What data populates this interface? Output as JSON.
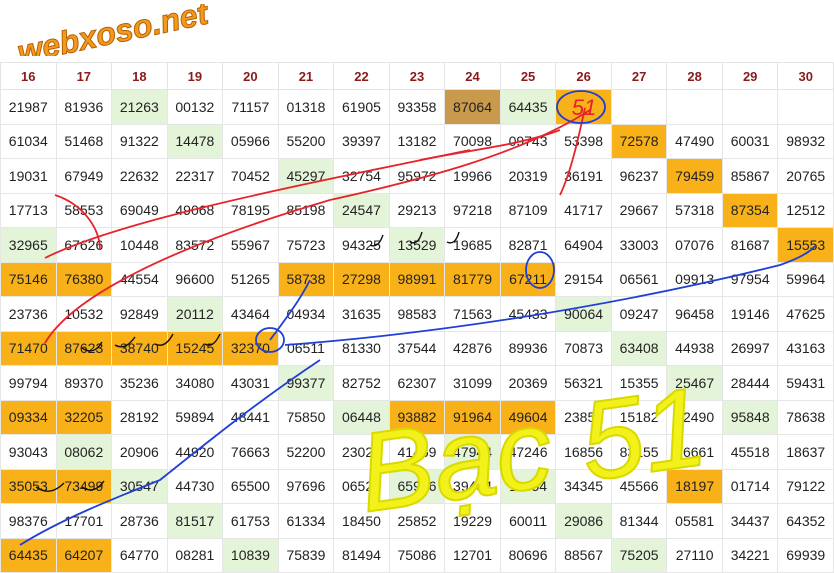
{
  "site": {
    "logo_text": "webxoso.net"
  },
  "columns": [
    "16",
    "17",
    "18",
    "19",
    "20",
    "21",
    "22",
    "23",
    "24",
    "25",
    "26",
    "27",
    "28",
    "29",
    "30"
  ],
  "rows": [
    [
      {
        "v": "21987"
      },
      {
        "v": "81936"
      },
      {
        "v": "21263",
        "c": "g"
      },
      {
        "v": "00132"
      },
      {
        "v": "71157"
      },
      {
        "v": "01318"
      },
      {
        "v": "61905"
      },
      {
        "v": "93358"
      },
      {
        "v": "87064",
        "c": "d"
      },
      {
        "v": "64435",
        "c": "g"
      },
      {
        "v": "",
        "c": "o"
      },
      {
        "v": ""
      },
      {
        "v": ""
      },
      {
        "v": ""
      },
      {
        "v": ""
      }
    ],
    [
      {
        "v": "61034"
      },
      {
        "v": "51468"
      },
      {
        "v": "91322"
      },
      {
        "v": "14478",
        "c": "g"
      },
      {
        "v": "05966"
      },
      {
        "v": "55200"
      },
      {
        "v": "39397"
      },
      {
        "v": "13182"
      },
      {
        "v": "70098"
      },
      {
        "v": "09743"
      },
      {
        "v": "53398"
      },
      {
        "v": "72578",
        "c": "o"
      },
      {
        "v": "47490"
      },
      {
        "v": "60031"
      },
      {
        "v": "98932"
      }
    ],
    [
      {
        "v": "19031"
      },
      {
        "v": "67949"
      },
      {
        "v": "22632"
      },
      {
        "v": "22317"
      },
      {
        "v": "70452"
      },
      {
        "v": "45297",
        "c": "g"
      },
      {
        "v": "32754"
      },
      {
        "v": "95972"
      },
      {
        "v": "19966"
      },
      {
        "v": "20319"
      },
      {
        "v": "36191"
      },
      {
        "v": "96237"
      },
      {
        "v": "79459",
        "c": "o"
      },
      {
        "v": "85867"
      },
      {
        "v": "20765"
      }
    ],
    [
      {
        "v": "17713"
      },
      {
        "v": "58553"
      },
      {
        "v": "69049"
      },
      {
        "v": "49068"
      },
      {
        "v": "78195"
      },
      {
        "v": "85198"
      },
      {
        "v": "24547",
        "c": "g"
      },
      {
        "v": "29213"
      },
      {
        "v": "97218"
      },
      {
        "v": "87109"
      },
      {
        "v": "41717"
      },
      {
        "v": "29667"
      },
      {
        "v": "57318"
      },
      {
        "v": "87354",
        "c": "o"
      },
      {
        "v": "12512"
      }
    ],
    [
      {
        "v": "32965",
        "c": "g"
      },
      {
        "v": "67626"
      },
      {
        "v": "10448"
      },
      {
        "v": "83572"
      },
      {
        "v": "55967"
      },
      {
        "v": "75723"
      },
      {
        "v": "94325"
      },
      {
        "v": "13529",
        "c": "g"
      },
      {
        "v": "19685"
      },
      {
        "v": "82871"
      },
      {
        "v": "64904"
      },
      {
        "v": "33003"
      },
      {
        "v": "07076"
      },
      {
        "v": "81687"
      },
      {
        "v": "15553",
        "c": "o"
      }
    ],
    [
      {
        "v": "75146",
        "c": "o"
      },
      {
        "v": "76380",
        "c": "o"
      },
      {
        "v": "44554"
      },
      {
        "v": "96600"
      },
      {
        "v": "51265"
      },
      {
        "v": "58738",
        "c": "o"
      },
      {
        "v": "27298",
        "c": "o"
      },
      {
        "v": "98991",
        "c": "o"
      },
      {
        "v": "81779",
        "c": "o"
      },
      {
        "v": "67211",
        "c": "o"
      },
      {
        "v": "29154"
      },
      {
        "v": "06561"
      },
      {
        "v": "09913"
      },
      {
        "v": "97954"
      },
      {
        "v": "59964"
      }
    ],
    [
      {
        "v": "23736"
      },
      {
        "v": "10532"
      },
      {
        "v": "92849"
      },
      {
        "v": "20112",
        "c": "g"
      },
      {
        "v": "43464"
      },
      {
        "v": "04934"
      },
      {
        "v": "31635"
      },
      {
        "v": "98583"
      },
      {
        "v": "71563"
      },
      {
        "v": "45433"
      },
      {
        "v": "90064",
        "c": "g"
      },
      {
        "v": "09247"
      },
      {
        "v": "96458"
      },
      {
        "v": "19146"
      },
      {
        "v": "47625"
      }
    ],
    [
      {
        "v": "71470",
        "c": "o"
      },
      {
        "v": "87623",
        "c": "o"
      },
      {
        "v": "38740",
        "c": "o"
      },
      {
        "v": "15245",
        "c": "o"
      },
      {
        "v": "32370",
        "c": "o"
      },
      {
        "v": "06511"
      },
      {
        "v": "81330"
      },
      {
        "v": "37544"
      },
      {
        "v": "42876"
      },
      {
        "v": "89936"
      },
      {
        "v": "70873"
      },
      {
        "v": "63408",
        "c": "g"
      },
      {
        "v": "44938"
      },
      {
        "v": "26997"
      },
      {
        "v": "43163"
      }
    ],
    [
      {
        "v": "99794"
      },
      {
        "v": "89370"
      },
      {
        "v": "35236"
      },
      {
        "v": "34080"
      },
      {
        "v": "43031"
      },
      {
        "v": "99377",
        "c": "g"
      },
      {
        "v": "82752"
      },
      {
        "v": "62307"
      },
      {
        "v": "31099"
      },
      {
        "v": "20369"
      },
      {
        "v": "56321"
      },
      {
        "v": "15355"
      },
      {
        "v": "25467",
        "c": "g"
      },
      {
        "v": "28444"
      },
      {
        "v": "59431"
      }
    ],
    [
      {
        "v": "09334",
        "c": "o"
      },
      {
        "v": "32205",
        "c": "o"
      },
      {
        "v": "28192"
      },
      {
        "v": "59894"
      },
      {
        "v": "48441"
      },
      {
        "v": "75850"
      },
      {
        "v": "06448",
        "c": "g"
      },
      {
        "v": "93882",
        "c": "o"
      },
      {
        "v": "91964",
        "c": "o"
      },
      {
        "v": "49604",
        "c": "o"
      },
      {
        "v": "23854"
      },
      {
        "v": "15182"
      },
      {
        "v": "92490"
      },
      {
        "v": "95848",
        "c": "g"
      },
      {
        "v": "78638"
      }
    ],
    [
      {
        "v": "93043"
      },
      {
        "v": "08062",
        "c": "g"
      },
      {
        "v": "20906"
      },
      {
        "v": "44920"
      },
      {
        "v": "76663"
      },
      {
        "v": "52200"
      },
      {
        "v": "23026"
      },
      {
        "v": "41469"
      },
      {
        "v": "47944",
        "c": "g"
      },
      {
        "v": "47246"
      },
      {
        "v": "16856"
      },
      {
        "v": "83155"
      },
      {
        "v": "16661"
      },
      {
        "v": "45518"
      },
      {
        "v": "18637"
      }
    ],
    [
      {
        "v": "35053",
        "c": "o"
      },
      {
        "v": "73499",
        "c": "o"
      },
      {
        "v": "30547",
        "c": "g"
      },
      {
        "v": "44730"
      },
      {
        "v": "65500"
      },
      {
        "v": "97696"
      },
      {
        "v": "06529"
      },
      {
        "v": "65996",
        "c": "g"
      },
      {
        "v": "39454"
      },
      {
        "v": "11954",
        "c": "g"
      },
      {
        "v": "34345"
      },
      {
        "v": "45566"
      },
      {
        "v": "18197",
        "c": "o"
      },
      {
        "v": "01714"
      },
      {
        "v": "79122"
      }
    ],
    [
      {
        "v": "98376"
      },
      {
        "v": "17701"
      },
      {
        "v": "28736"
      },
      {
        "v": "81517",
        "c": "g"
      },
      {
        "v": "61753"
      },
      {
        "v": "61334"
      },
      {
        "v": "18450"
      },
      {
        "v": "25852"
      },
      {
        "v": "19229"
      },
      {
        "v": "60011"
      },
      {
        "v": "29086",
        "c": "g"
      },
      {
        "v": "81344"
      },
      {
        "v": "05581"
      },
      {
        "v": "34437"
      },
      {
        "v": "64352"
      }
    ],
    [
      {
        "v": "64435",
        "c": "o"
      },
      {
        "v": "64207",
        "c": "o"
      },
      {
        "v": "64770"
      },
      {
        "v": "08281"
      },
      {
        "v": "10839",
        "c": "g"
      },
      {
        "v": "75839"
      },
      {
        "v": "81494"
      },
      {
        "v": "75086"
      },
      {
        "v": "12701"
      },
      {
        "v": "80696"
      },
      {
        "v": "88567"
      },
      {
        "v": "75205",
        "c": "g"
      },
      {
        "v": "27110"
      },
      {
        "v": "34221"
      },
      {
        "v": "69939"
      }
    ]
  ],
  "annotations": {
    "handwritten_text": "Bạc 51",
    "circled_value": "51",
    "colors": {
      "red": "#e8222b",
      "blue": "#1f3fd6",
      "yellow": "#f2f21a"
    }
  }
}
